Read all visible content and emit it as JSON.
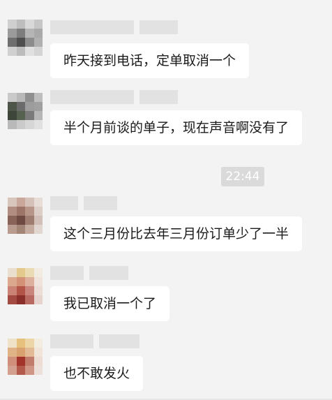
{
  "messages": [
    {
      "text": "昨天接到电话，定单取消一个"
    },
    {
      "text": "半个月前谈的单子，现在声音啊没有了"
    },
    {
      "text": "这个三月份比去年三月份订单少了一半"
    },
    {
      "text": "我已取消一个了"
    },
    {
      "text": "也不敢发火"
    }
  ],
  "timestamp": "22:44",
  "colors": {
    "background": "#f3f3f3",
    "bubble": "#ffffff",
    "timestamp_bg": "#dadada",
    "blur_name": "#e2e2e2"
  }
}
